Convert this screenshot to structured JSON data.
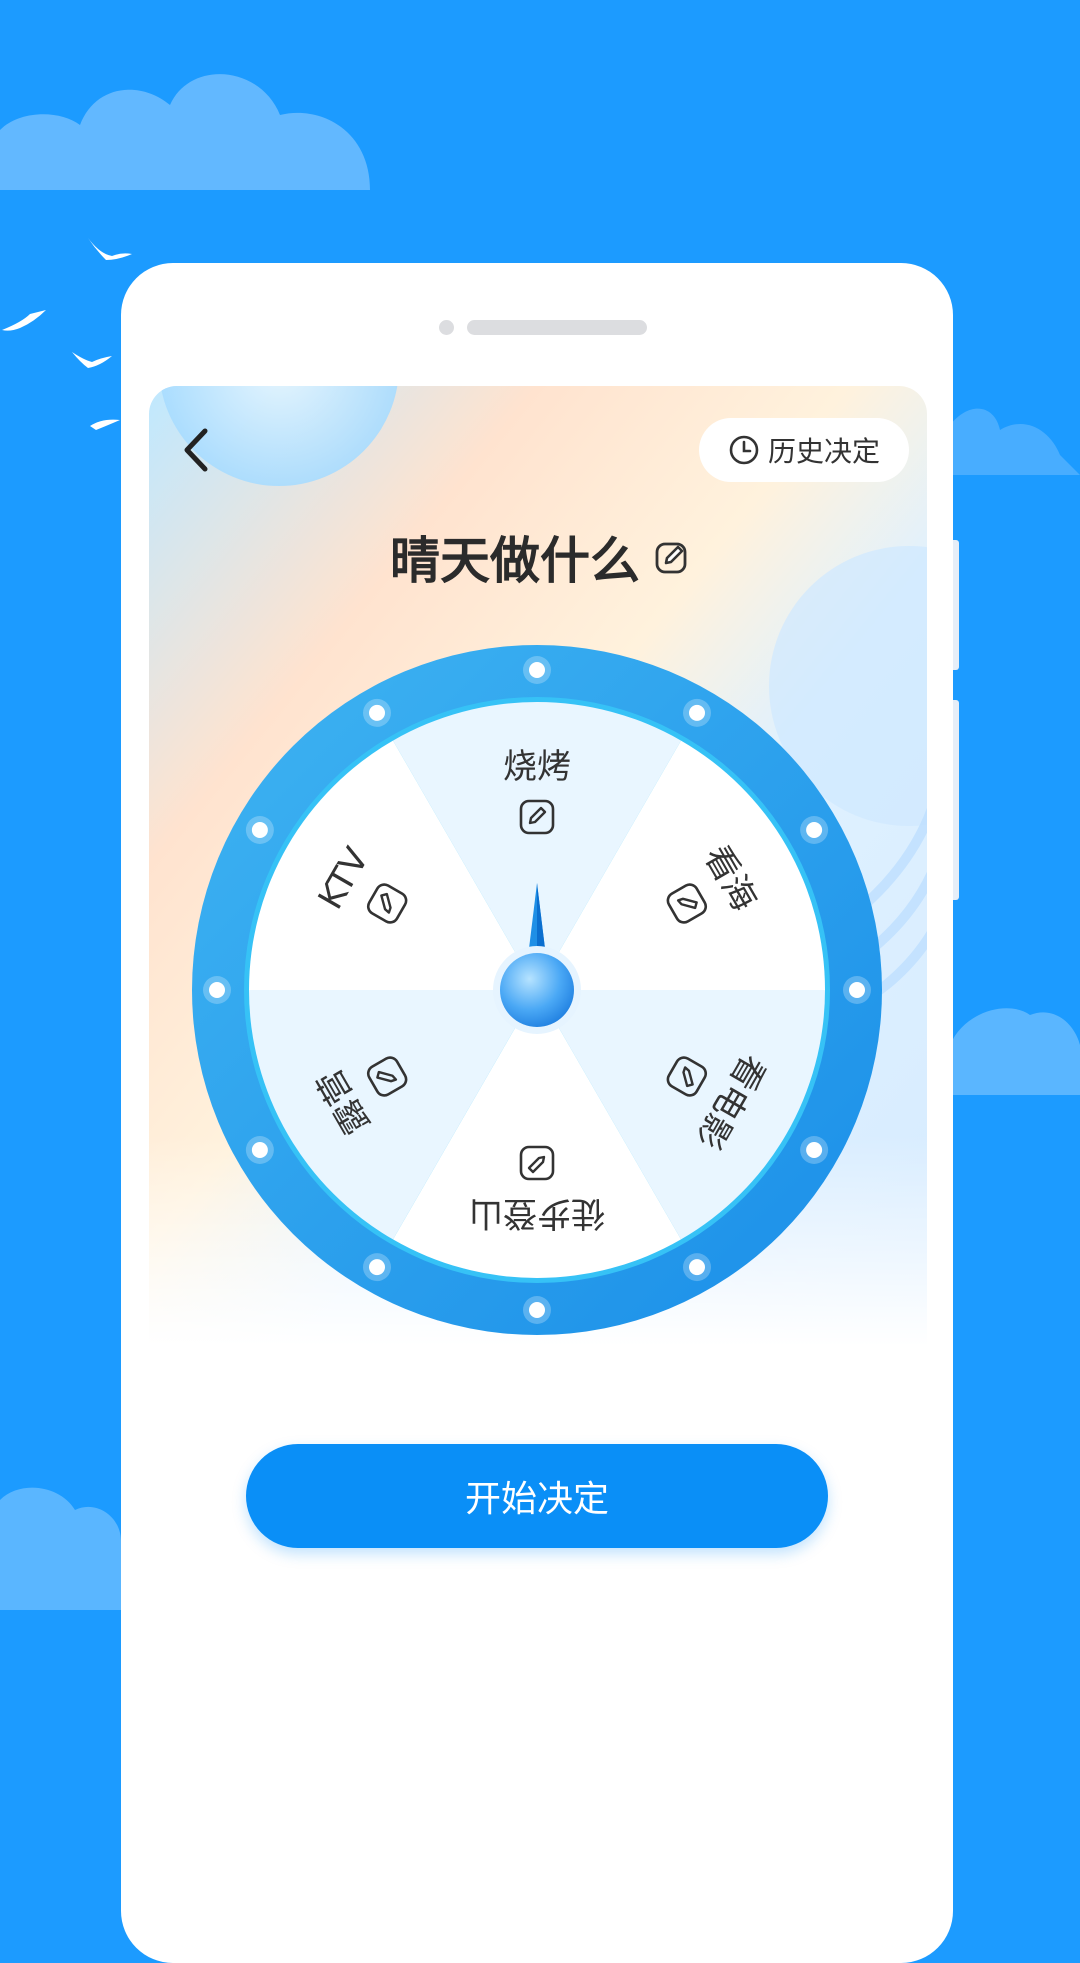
{
  "header": {
    "history_label": "历史决定",
    "title": "晴天做什么"
  },
  "wheel": {
    "segments": [
      {
        "label": "烧烤"
      },
      {
        "label": "看海"
      },
      {
        "label": "看电影"
      },
      {
        "label": "徒步登山"
      },
      {
        "label": "露营"
      },
      {
        "label": "KTV"
      }
    ]
  },
  "actions": {
    "start_label": "开始决定"
  },
  "icons": {
    "back": "chevron-left-icon",
    "history": "clock-icon",
    "edit": "edit-icon"
  },
  "colors": {
    "background": "#1c9bff",
    "wheel_rim": "#2aa0ee",
    "button": "#0a8ff7"
  }
}
